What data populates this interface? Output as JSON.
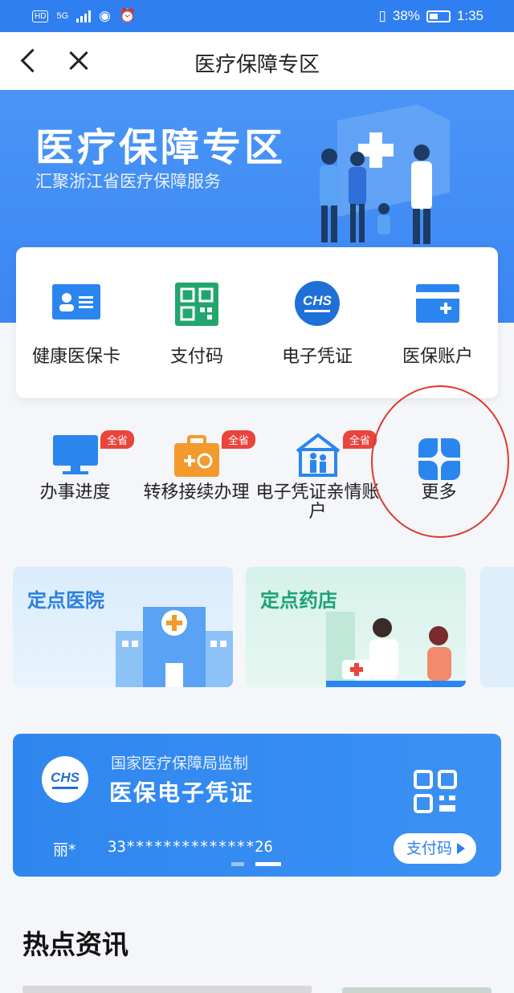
{
  "status_bar": {
    "hd": "HD",
    "network": "5G",
    "battery": "38%",
    "time": "1:35"
  },
  "nav": {
    "title": "医疗保障专区"
  },
  "banner": {
    "title": "医疗保障专区",
    "subtitle": "汇聚浙江省医疗保障服务"
  },
  "quick_actions": [
    {
      "label": "健康医保卡",
      "icon": "health-card-icon"
    },
    {
      "label": "支付码",
      "icon": "qr-code-icon"
    },
    {
      "label": "电子凭证",
      "icon": "chs-logo-icon"
    },
    {
      "label": "医保账户",
      "icon": "account-wallet-icon"
    }
  ],
  "services": [
    {
      "label": "办事进度",
      "badge": "全省",
      "icon": "monitor-icon"
    },
    {
      "label": "转移接续办理",
      "badge": "全省",
      "icon": "transfer-briefcase-icon"
    },
    {
      "label": "电子凭证亲情账户",
      "badge": "全省",
      "icon": "family-house-icon"
    },
    {
      "label": "更多",
      "badge": "",
      "icon": "more-grid-icon"
    }
  ],
  "tiles": [
    {
      "title": "定点医院"
    },
    {
      "title": "定点药店"
    }
  ],
  "voucher": {
    "supervisor": "国家医疗保障局监制",
    "title": "医保电子凭证",
    "name": "丽*",
    "number": "33**************26",
    "pay_button": "支付码",
    "logo_text": "CHS"
  },
  "news": {
    "heading": "热点资讯"
  },
  "colors": {
    "primary": "#3b86f2",
    "badge": "#e8453c",
    "annotation_circle": "#e03a2f"
  }
}
